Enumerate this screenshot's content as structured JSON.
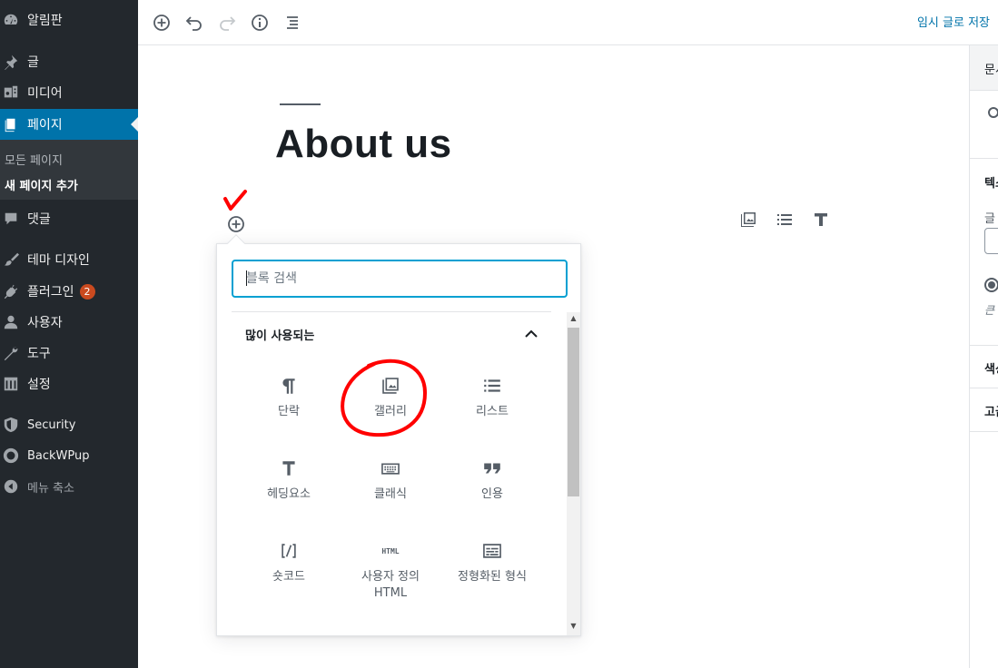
{
  "admin_menu": {
    "items": [
      {
        "label": "알림판",
        "icon": "dashboard-icon"
      },
      {
        "label": "글",
        "icon": "pin-icon"
      },
      {
        "label": "미디어",
        "icon": "media-icon"
      },
      {
        "label": "페이지",
        "icon": "page-icon",
        "current": true
      },
      {
        "label": "댓글",
        "icon": "comment-icon"
      },
      {
        "label": "테마 디자인",
        "icon": "brush-icon"
      },
      {
        "label": "플러그인",
        "icon": "plugin-icon",
        "badge": "2"
      },
      {
        "label": "사용자",
        "icon": "user-icon"
      },
      {
        "label": "도구",
        "icon": "wrench-icon"
      },
      {
        "label": "설정",
        "icon": "settings-icon"
      },
      {
        "label": "Security",
        "icon": "shield-icon"
      },
      {
        "label": "BackWPup",
        "icon": "backwpup-icon"
      },
      {
        "label": "메뉴 축소",
        "icon": "collapse-icon"
      }
    ],
    "submenu": [
      "모든 페이지",
      "새 페이지 추가"
    ]
  },
  "toolbar": {
    "save_draft": "임시 글로 저장"
  },
  "settings_sidebar": {
    "tab": "문서",
    "section1": "텍스",
    "label1": "글",
    "hint": "큰",
    "section2": "색상",
    "section3": "고급"
  },
  "post": {
    "title": "About us"
  },
  "inserter": {
    "search_placeholder": "블록 검색",
    "panel_title": "많이 사용되는",
    "blocks": [
      {
        "label": "단락",
        "icon": "paragraph-icon"
      },
      {
        "label": "갤러리",
        "icon": "gallery-icon"
      },
      {
        "label": "리스트",
        "icon": "list-icon"
      },
      {
        "label": "헤딩요소",
        "icon": "heading-icon"
      },
      {
        "label": "클래식",
        "icon": "keyboard-icon"
      },
      {
        "label": "인용",
        "icon": "quote-icon"
      },
      {
        "label": "숏코드",
        "icon": "shortcode-icon"
      },
      {
        "label": "사용자 정의 HTML",
        "icon": "html-icon"
      },
      {
        "label": "정형화된 형식",
        "icon": "preformatted-icon"
      }
    ]
  },
  "html_icon_text": "HTML",
  "colors": {
    "admin_bg": "#23282d",
    "admin_accent": "#0073aa",
    "search_focus": "#00a0d2",
    "annotation_red": "#ff0000"
  }
}
